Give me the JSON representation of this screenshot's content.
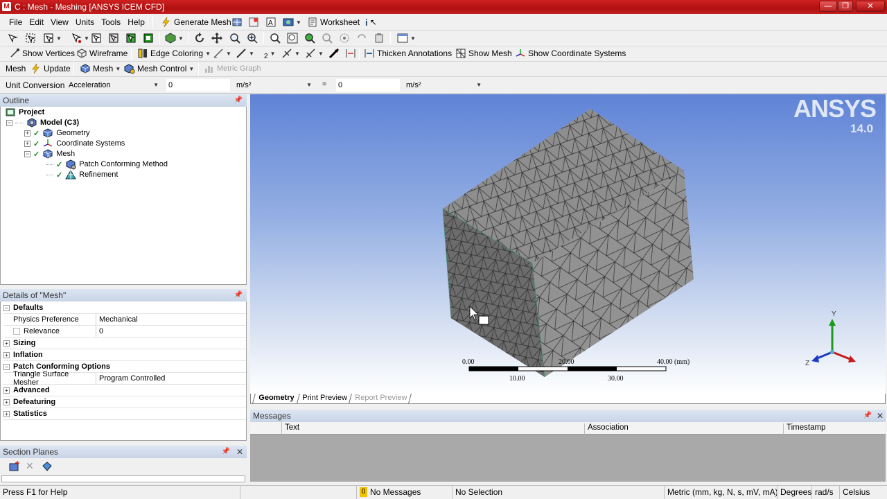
{
  "window": {
    "title": "C : Mesh - Meshing [ANSYS ICEM CFD]",
    "app_icon_letter": "M"
  },
  "menu": {
    "items": [
      "File",
      "Edit",
      "View",
      "Units",
      "Tools",
      "Help"
    ],
    "generate_mesh": "Generate Mesh",
    "worksheet": "Worksheet"
  },
  "toolbar3": {
    "show_vertices": "Show Vertices",
    "wireframe": "Wireframe",
    "edge_coloring": "Edge Coloring",
    "thicken_annotations": "Thicken Annotations",
    "show_mesh": "Show Mesh",
    "show_coordinate_systems": "Show Coordinate Systems",
    "num_label": "2"
  },
  "toolbar4": {
    "mesh": "Mesh",
    "update": "Update",
    "mesh_dropdown": "Mesh",
    "mesh_control": "Mesh Control",
    "metric_graph": "Metric Graph"
  },
  "unit_conversion": {
    "label": "Unit Conversion",
    "quantity": "Acceleration",
    "value_from": "0",
    "unit_from": "m/s²",
    "equals": "=",
    "value_to": "0",
    "unit_to": "m/s²"
  },
  "outline": {
    "title": "Outline",
    "project": "Project",
    "model": "Model (C3)",
    "geometry": "Geometry",
    "coordinate_systems": "Coordinate Systems",
    "mesh": "Mesh",
    "patch_conforming": "Patch Conforming Method",
    "refinement": "Refinement"
  },
  "details": {
    "title": "Details of \"Mesh\"",
    "defaults": "Defaults",
    "physics_preference_label": "Physics Preference",
    "physics_preference_value": "Mechanical",
    "relevance_label": "Relevance",
    "relevance_value": "0",
    "sizing": "Sizing",
    "inflation": "Inflation",
    "patch_conforming_options": "Patch Conforming Options",
    "triangle_surface_mesher_label": "Triangle Surface Mesher",
    "triangle_surface_mesher_value": "Program Controlled",
    "advanced": "Advanced",
    "defeaturing": "Defeaturing",
    "statistics": "Statistics"
  },
  "section_planes": {
    "title": "Section Planes"
  },
  "viewport": {
    "logo": "ANSYS",
    "version": "14.0",
    "scale_labels": {
      "t0": "0.00",
      "t20": "20.00",
      "t40": "40.00 (mm)",
      "t10": "10.00",
      "t30": "30.00"
    },
    "axis_labels": {
      "y": "Y",
      "z": "Z"
    }
  },
  "view_tabs": {
    "geometry": "Geometry",
    "print_preview": "Print Preview",
    "report_preview": "Report Preview"
  },
  "messages": {
    "title": "Messages",
    "col_text": "Text",
    "col_association": "Association",
    "col_timestamp": "Timestamp"
  },
  "statusbar": {
    "help": "Press F1 for Help",
    "msg_count": "0",
    "no_messages": "No Messages",
    "no_selection": "No Selection",
    "units": "Metric (mm, kg, N, s, mV, mA)",
    "degrees": "Degrees",
    "rads": "rad/s",
    "celsius": "Celsius"
  },
  "colors": {
    "title_red": "#c11a1a",
    "viewport_top": "#5f83d6",
    "mesh_gray": "#8c8c8c",
    "panel_header": "#c8d4e6"
  }
}
